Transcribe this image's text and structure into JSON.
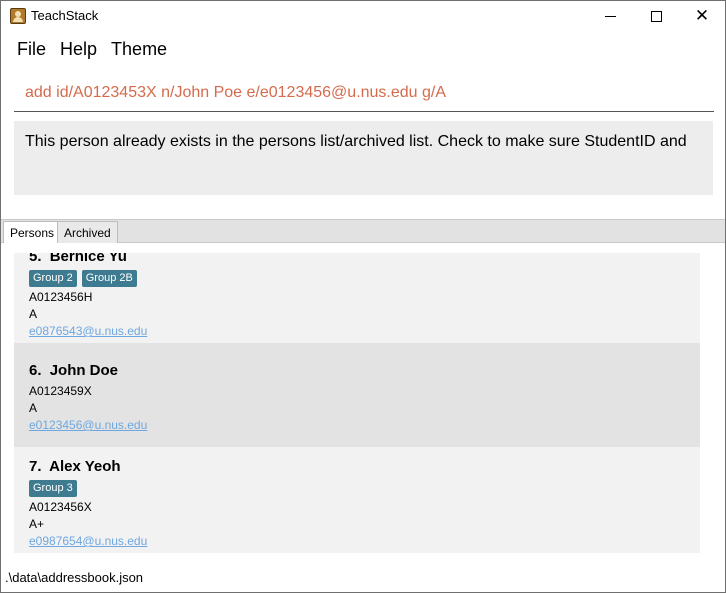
{
  "window": {
    "title": "TeachStack",
    "minimize_icon": "minimize-icon",
    "maximize_icon": "maximize-icon",
    "close_icon": "close-icon",
    "close_glyph": "✕"
  },
  "menu": [
    "File",
    "Help",
    "Theme"
  ],
  "command": {
    "value": "add id/A0123453X n/John Poe e/e0123456@u.nus.edu g/A",
    "text_color": "#d56b4c"
  },
  "result": {
    "message": "This person already exists in the persons list/archived list. Check to make sure StudentID and"
  },
  "tabs": [
    {
      "label": "Persons",
      "active": true
    },
    {
      "label": "Archived",
      "active": false
    }
  ],
  "persons": [
    {
      "index": "5.",
      "name": "Bernice Yu",
      "tags": [
        "Group 2",
        "Group 2B"
      ],
      "id": "A0123456H",
      "grade": "A",
      "email": "e0876543@u.nus.edu"
    },
    {
      "index": "6.",
      "name": "John Doe",
      "tags": [],
      "id": "A0123459X",
      "grade": "A",
      "email": "e0123456@u.nus.edu"
    },
    {
      "index": "7.",
      "name": "Alex Yeoh",
      "tags": [
        "Group 3"
      ],
      "id": "A0123456X",
      "grade": "A+",
      "email": "e0987654@u.nus.edu"
    }
  ],
  "status": {
    "file_path": ".\\data\\addressbook.json"
  },
  "colors": {
    "tag_bg": "#3e7b91",
    "email_link": "#6fa7e0"
  }
}
